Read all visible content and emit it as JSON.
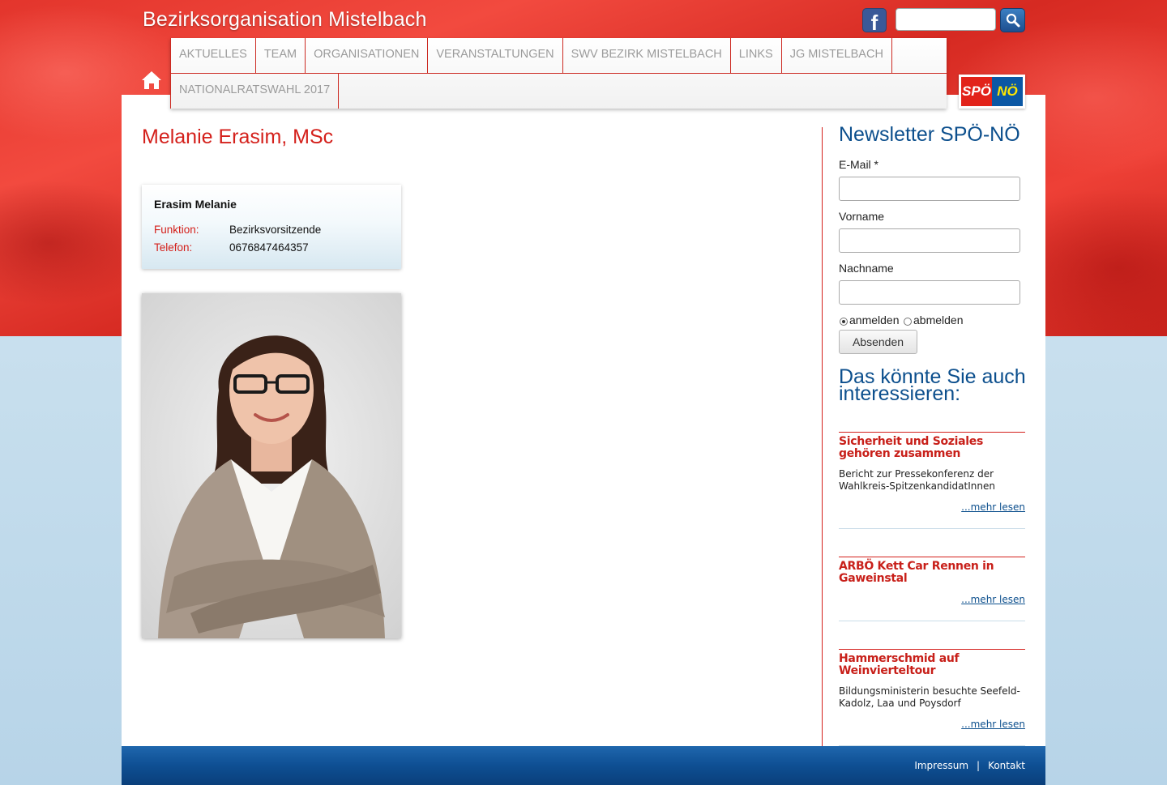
{
  "header": {
    "site_title": "Bezirksorganisation Mistelbach",
    "search_placeholder": "",
    "logo_left": "SPÖ",
    "logo_right": "NÖ"
  },
  "nav": {
    "row1": [
      "AKTUELLES",
      "TEAM",
      "ORGANISATIONEN",
      "VERANSTALTUNGEN",
      "SWV BEZIRK MISTELBACH",
      "LINKS",
      "JG MISTELBACH"
    ],
    "row2": [
      "NATIONALRATSWAHL 2017"
    ]
  },
  "main": {
    "page_title": "Melanie Erasim, MSc",
    "card": {
      "name": "Erasim Melanie",
      "function_label": "Funktion:",
      "function_value": "Bezirksvorsitzende",
      "phone_label": "Telefon:",
      "phone_value": "0676847464357"
    }
  },
  "sidebar": {
    "newsletter_title": "Newsletter SPÖ-NÖ",
    "email_label": "E-Mail *",
    "firstname_label": "Vorname",
    "lastname_label": "Nachname",
    "radio_subscribe": "anmelden",
    "radio_unsubscribe": "abmelden",
    "submit_label": "Absenden",
    "related_title": "Das könnte Sie auch interessieren:",
    "articles": [
      {
        "title": "Sicherheit und Soziales gehören zusammen",
        "text": "Bericht zur Pressekonferenz der Wahlkreis-SpitzenkandidatInnen",
        "more": "...mehr lesen"
      },
      {
        "title": "ARBÖ Kett Car Rennen in Gaweinstal",
        "text": "",
        "more": "...mehr lesen"
      },
      {
        "title": "Hammerschmid auf Weinvierteltour",
        "text": "Bildungsministerin besuchte Seefeld-Kadolz, Laa und Poysdorf",
        "more": "...mehr lesen"
      }
    ]
  },
  "footer": {
    "impressum": "Impressum",
    "separator": "|",
    "kontakt": "Kontakt"
  },
  "colors": {
    "brand_red": "#d4201b",
    "brand_blue": "#0c4f8d"
  }
}
